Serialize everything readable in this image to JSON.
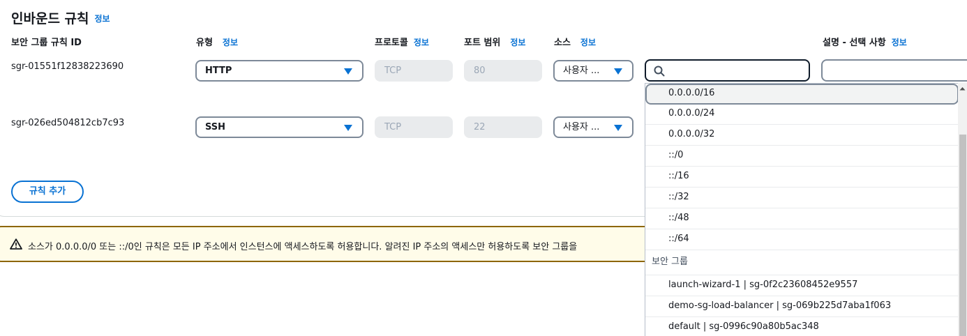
{
  "section": {
    "title": "인바운드 규칙",
    "info": "정보"
  },
  "columns": {
    "rule_id": "보안 그룹 규칙 ID",
    "type": "유형",
    "protocol": "프로토콜",
    "port_range": "포트 범위",
    "source": "소스",
    "description": "설명 - 선택 사항",
    "info": "정보"
  },
  "rules": [
    {
      "id": "sgr-01551f12838223690",
      "type": "HTTP",
      "protocol": "TCP",
      "port": "80",
      "source": "사용자 ..."
    },
    {
      "id": "sgr-026ed504812cb7c93",
      "type": "SSH",
      "protocol": "TCP",
      "port": "22",
      "source": "사용자 ..."
    }
  ],
  "search": {
    "value": "",
    "placeholder": ""
  },
  "description": {
    "value": ""
  },
  "add_rule_label": "규칙 추가",
  "warning": {
    "text": "소스가 0.0.0.0/0 또는 ::/0인 규칙은 모든 IP 주소에서 인스턴스에 액세스하도록 허용합니다. 알려진 IP 주소의 액세스만 허용하도록 보안 그룹을"
  },
  "dropdown": {
    "cidr_options": [
      "0.0.0.0/16",
      "0.0.0.0/24",
      "0.0.0.0/32",
      "::/0",
      "::/16",
      "::/32",
      "::/48",
      "::/64"
    ],
    "group_label": "보안 그룹",
    "security_groups": [
      "launch-wizard-1 | sg-0f2c23608452e9557",
      "demo-sg-load-balancer | sg-069b225d7aba1f063",
      "default | sg-0996c90a80b5ac348"
    ]
  },
  "colors": {
    "accent": "#0972d3",
    "warning_border": "#8d6605",
    "warning_bg": "#fffce9"
  }
}
